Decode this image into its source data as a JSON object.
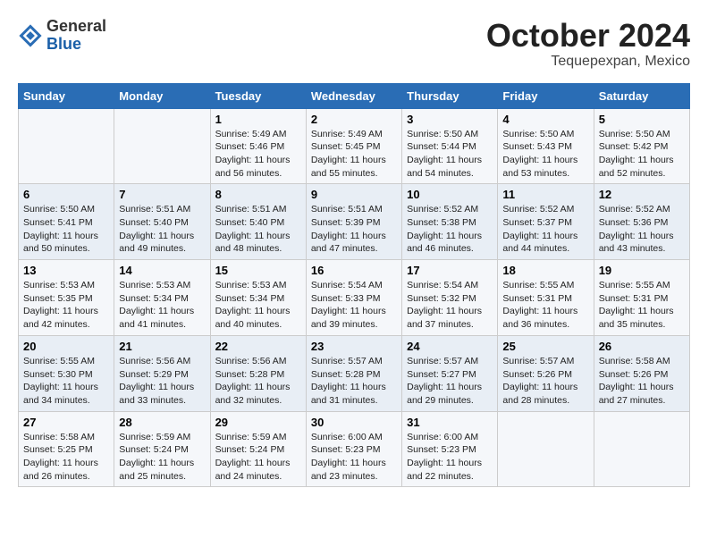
{
  "header": {
    "logo_general": "General",
    "logo_blue": "Blue",
    "month_title": "October 2024",
    "location": "Tequepexpan, Mexico"
  },
  "columns": [
    "Sunday",
    "Monday",
    "Tuesday",
    "Wednesday",
    "Thursday",
    "Friday",
    "Saturday"
  ],
  "weeks": [
    [
      {
        "day": "",
        "content": ""
      },
      {
        "day": "",
        "content": ""
      },
      {
        "day": "1",
        "content": "Sunrise: 5:49 AM\nSunset: 5:46 PM\nDaylight: 11 hours and 56 minutes."
      },
      {
        "day": "2",
        "content": "Sunrise: 5:49 AM\nSunset: 5:45 PM\nDaylight: 11 hours and 55 minutes."
      },
      {
        "day": "3",
        "content": "Sunrise: 5:50 AM\nSunset: 5:44 PM\nDaylight: 11 hours and 54 minutes."
      },
      {
        "day": "4",
        "content": "Sunrise: 5:50 AM\nSunset: 5:43 PM\nDaylight: 11 hours and 53 minutes."
      },
      {
        "day": "5",
        "content": "Sunrise: 5:50 AM\nSunset: 5:42 PM\nDaylight: 11 hours and 52 minutes."
      }
    ],
    [
      {
        "day": "6",
        "content": "Sunrise: 5:50 AM\nSunset: 5:41 PM\nDaylight: 11 hours and 50 minutes."
      },
      {
        "day": "7",
        "content": "Sunrise: 5:51 AM\nSunset: 5:40 PM\nDaylight: 11 hours and 49 minutes."
      },
      {
        "day": "8",
        "content": "Sunrise: 5:51 AM\nSunset: 5:40 PM\nDaylight: 11 hours and 48 minutes."
      },
      {
        "day": "9",
        "content": "Sunrise: 5:51 AM\nSunset: 5:39 PM\nDaylight: 11 hours and 47 minutes."
      },
      {
        "day": "10",
        "content": "Sunrise: 5:52 AM\nSunset: 5:38 PM\nDaylight: 11 hours and 46 minutes."
      },
      {
        "day": "11",
        "content": "Sunrise: 5:52 AM\nSunset: 5:37 PM\nDaylight: 11 hours and 44 minutes."
      },
      {
        "day": "12",
        "content": "Sunrise: 5:52 AM\nSunset: 5:36 PM\nDaylight: 11 hours and 43 minutes."
      }
    ],
    [
      {
        "day": "13",
        "content": "Sunrise: 5:53 AM\nSunset: 5:35 PM\nDaylight: 11 hours and 42 minutes."
      },
      {
        "day": "14",
        "content": "Sunrise: 5:53 AM\nSunset: 5:34 PM\nDaylight: 11 hours and 41 minutes."
      },
      {
        "day": "15",
        "content": "Sunrise: 5:53 AM\nSunset: 5:34 PM\nDaylight: 11 hours and 40 minutes."
      },
      {
        "day": "16",
        "content": "Sunrise: 5:54 AM\nSunset: 5:33 PM\nDaylight: 11 hours and 39 minutes."
      },
      {
        "day": "17",
        "content": "Sunrise: 5:54 AM\nSunset: 5:32 PM\nDaylight: 11 hours and 37 minutes."
      },
      {
        "day": "18",
        "content": "Sunrise: 5:55 AM\nSunset: 5:31 PM\nDaylight: 11 hours and 36 minutes."
      },
      {
        "day": "19",
        "content": "Sunrise: 5:55 AM\nSunset: 5:31 PM\nDaylight: 11 hours and 35 minutes."
      }
    ],
    [
      {
        "day": "20",
        "content": "Sunrise: 5:55 AM\nSunset: 5:30 PM\nDaylight: 11 hours and 34 minutes."
      },
      {
        "day": "21",
        "content": "Sunrise: 5:56 AM\nSunset: 5:29 PM\nDaylight: 11 hours and 33 minutes."
      },
      {
        "day": "22",
        "content": "Sunrise: 5:56 AM\nSunset: 5:28 PM\nDaylight: 11 hours and 32 minutes."
      },
      {
        "day": "23",
        "content": "Sunrise: 5:57 AM\nSunset: 5:28 PM\nDaylight: 11 hours and 31 minutes."
      },
      {
        "day": "24",
        "content": "Sunrise: 5:57 AM\nSunset: 5:27 PM\nDaylight: 11 hours and 29 minutes."
      },
      {
        "day": "25",
        "content": "Sunrise: 5:57 AM\nSunset: 5:26 PM\nDaylight: 11 hours and 28 minutes."
      },
      {
        "day": "26",
        "content": "Sunrise: 5:58 AM\nSunset: 5:26 PM\nDaylight: 11 hours and 27 minutes."
      }
    ],
    [
      {
        "day": "27",
        "content": "Sunrise: 5:58 AM\nSunset: 5:25 PM\nDaylight: 11 hours and 26 minutes."
      },
      {
        "day": "28",
        "content": "Sunrise: 5:59 AM\nSunset: 5:24 PM\nDaylight: 11 hours and 25 minutes."
      },
      {
        "day": "29",
        "content": "Sunrise: 5:59 AM\nSunset: 5:24 PM\nDaylight: 11 hours and 24 minutes."
      },
      {
        "day": "30",
        "content": "Sunrise: 6:00 AM\nSunset: 5:23 PM\nDaylight: 11 hours and 23 minutes."
      },
      {
        "day": "31",
        "content": "Sunrise: 6:00 AM\nSunset: 5:23 PM\nDaylight: 11 hours and 22 minutes."
      },
      {
        "day": "",
        "content": ""
      },
      {
        "day": "",
        "content": ""
      }
    ]
  ]
}
